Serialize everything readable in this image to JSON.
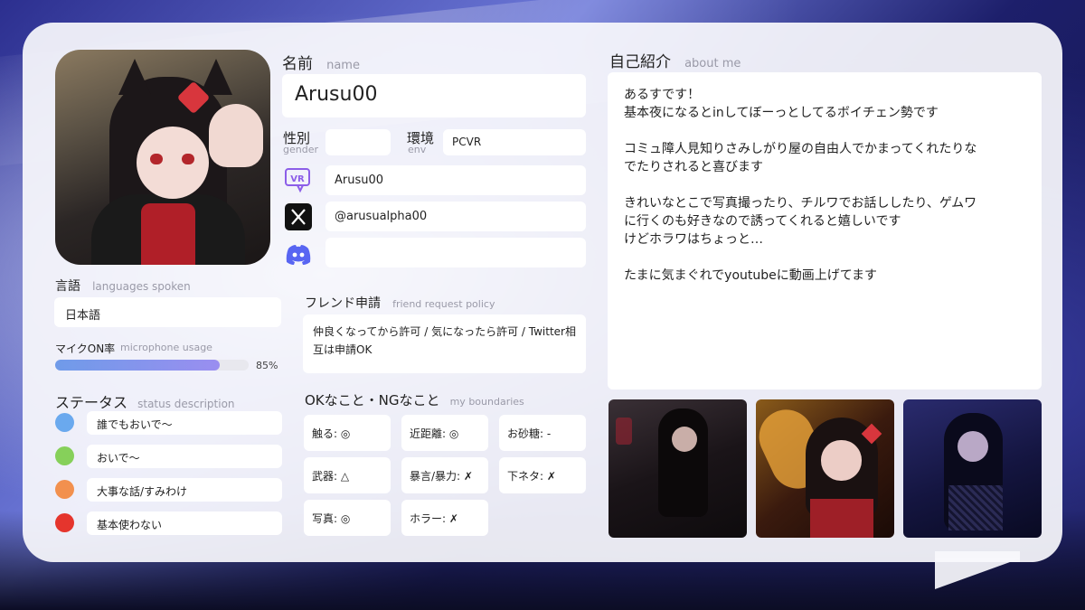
{
  "name": {
    "label_ja": "名前",
    "label_en": "name",
    "value": "Arusu00"
  },
  "gender": {
    "label_ja": "性別",
    "label_en": "gender",
    "value": ""
  },
  "env": {
    "label_ja": "環境",
    "label_en": "env",
    "value": "PCVR"
  },
  "social": {
    "vrchat": {
      "icon": "vrchat-icon",
      "value": "Arusu00"
    },
    "x": {
      "icon": "x-icon",
      "value": "@arusualpha00"
    },
    "discord": {
      "icon": "discord-icon",
      "value": ""
    }
  },
  "languages": {
    "label_ja": "言語",
    "label_en": "languages spoken",
    "value": "日本語"
  },
  "mic": {
    "label_ja": "マイクON率",
    "label_en": "microphone usage",
    "percent": 85,
    "percent_label": "85%"
  },
  "status": {
    "label_ja": "ステータス",
    "label_en": "status description",
    "items": [
      {
        "color": "#6aa9ee",
        "text": "誰でもおいで〜"
      },
      {
        "color": "#86d05a",
        "text": "おいで〜"
      },
      {
        "color": "#f2904e",
        "text": "大事な話/すみわけ"
      },
      {
        "color": "#e5352d",
        "text": "基本使わない"
      }
    ]
  },
  "friend_request": {
    "label_ja": "フレンド申請",
    "label_en": "friend request policy",
    "value": "仲良くなってから許可 / 気になったら許可 / Twitter相互は申請OK"
  },
  "boundaries": {
    "label_ja": "OKなこと・NGなこと",
    "label_en": "my boundaries",
    "items": [
      "触る: ◎",
      "近距離: ◎",
      "お砂糖: -",
      "武器: △",
      "暴言/暴力: ✗",
      "下ネタ: ✗",
      "写真: ◎",
      "ホラー: ✗"
    ]
  },
  "about": {
    "label_ja": "自己紹介",
    "label_en": "about me",
    "value": "あるすです！\n基本夜になるとinしてぼーっとしてるボイチェン勢です\n\nコミュ障人見知りさみしがり屋の自由人でかまってくれたりな\nでたりされると喜びます\n\nきれいなとこで写真撮ったり、チルワでお話ししたり、ゲムワ\nに行くのも好きなので誘ってくれると嬉しいです\nけどホラワはちょっと…\n\nたまに気まぐれでyoutubeに動画上げてます"
  }
}
